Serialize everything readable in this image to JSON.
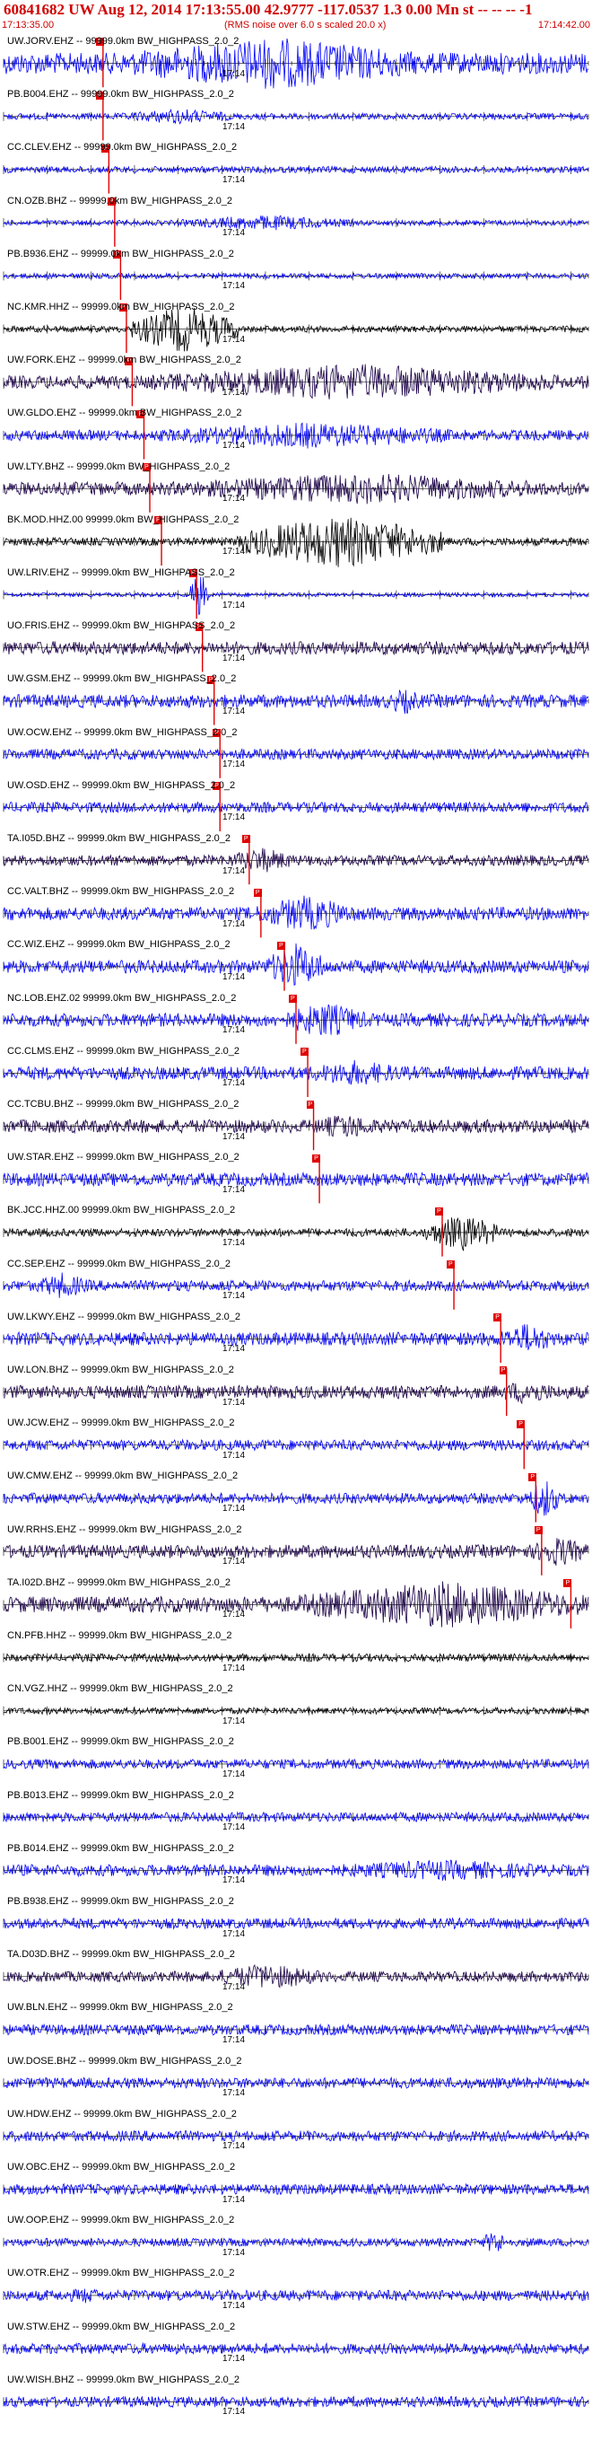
{
  "header": {
    "title": "60841682 UW Aug 12, 2014 17:13:55.00   42.9777 -117.0537  1.3 0.00 Mn st -- -- --  -1",
    "start_time": "17:13:35.00",
    "rms_note": "(RMS noise over 6.0 s scaled 20.0 x)",
    "end_time": "17:14:42.00"
  },
  "tick_time": "17:14",
  "colors": {
    "header_red": "#d00000",
    "blue": "#0000ff",
    "dark": "#1a0046",
    "black": "#000000",
    "pick": "#e00000"
  },
  "traces": [
    {
      "label": "UW.JORV.EHZ -- 99999.0km BW_HIGHPASS_2.0_2",
      "color": "blue",
      "amp": 0.4,
      "pick": 0.17,
      "event": [
        0.2,
        0.72,
        1.0
      ]
    },
    {
      "label": "PB.B004.EHZ -- 99999.0km BW_HIGHPASS_2.0_2",
      "color": "blue",
      "amp": 0.12,
      "pick": 0.17,
      "event": [
        0.2,
        0.4,
        0.3
      ]
    },
    {
      "label": "CC.CLEV.EHZ -- 99999.0km BW_HIGHPASS_2.0_2",
      "color": "blue",
      "amp": 0.12,
      "pick": 0.18
    },
    {
      "label": "CN.OZB.BHZ -- 99999.0km BW_HIGHPASS_2.0_2",
      "color": "blue",
      "amp": 0.1,
      "pick": 0.19,
      "event": [
        0.3,
        0.6,
        0.3
      ]
    },
    {
      "label": "PB.B936.EHZ -- 99999.0km BW_HIGHPASS_2.0_2",
      "color": "blue",
      "amp": 0.1,
      "pick": 0.2
    },
    {
      "label": "NC.KMR.HHZ -- 99999.0km BW_HIGHPASS_2.0_2",
      "color": "black",
      "amp": 0.12,
      "pick": 0.21,
      "event": [
        0.22,
        0.4,
        0.9
      ]
    },
    {
      "label": "UW.FORK.EHZ -- 99999.0km BW_HIGHPASS_2.0_2",
      "color": "dark",
      "amp": 0.25,
      "pick": 0.22,
      "event": [
        0.25,
        0.95,
        0.7
      ]
    },
    {
      "label": "UW.GLDO.EHZ -- 99999.0km BW_HIGHPASS_2.0_2",
      "color": "blue",
      "amp": 0.2,
      "pick": 0.24,
      "event": [
        0.25,
        0.8,
        0.5
      ]
    },
    {
      "label": "UW.LTY.BHZ -- 99999.0km BW_HIGHPASS_2.0_2",
      "color": "dark",
      "amp": 0.25,
      "pick": 0.25,
      "event": [
        0.28,
        0.95,
        0.6
      ]
    },
    {
      "label": "BK.MOD.HHZ.00 99999.0km BW_HIGHPASS_2.0_2",
      "color": "black",
      "amp": 0.15,
      "pick": 0.27,
      "event": [
        0.4,
        0.75,
        1.0
      ]
    },
    {
      "label": "UW.LRIV.EHZ -- 99999.0km BW_HIGHPASS_2.0_2",
      "color": "blue",
      "amp": 0.08,
      "pick": 0.33,
      "event": [
        0.32,
        0.35,
        0.9
      ]
    },
    {
      "label": "UO.FRIS.EHZ -- 99999.0km BW_HIGHPASS_2.0_2",
      "color": "dark",
      "amp": 0.25,
      "pick": 0.34
    },
    {
      "label": "UW.GSM.EHZ -- 99999.0km BW_HIGHPASS_2.0_2",
      "color": "blue",
      "amp": 0.25,
      "pick": 0.36,
      "event": [
        0.65,
        0.72,
        0.5
      ]
    },
    {
      "label": "UW.OCW.EHZ -- 99999.0km BW_HIGHPASS_2.0_2",
      "color": "blue",
      "amp": 0.2,
      "pick": 0.37
    },
    {
      "label": "UW.OSD.EHZ -- 99999.0km BW_HIGHPASS_2.0_2",
      "color": "blue",
      "amp": 0.2,
      "pick": 0.37
    },
    {
      "label": "TA.I05D.BHZ -- 99999.0km BW_HIGHPASS_2.0_2",
      "color": "dark",
      "amp": 0.2,
      "pick": 0.42,
      "event": [
        0.38,
        0.5,
        0.5
      ]
    },
    {
      "label": "CC.VALT.BHZ -- 99999.0km BW_HIGHPASS_2.0_2",
      "color": "blue",
      "amp": 0.25,
      "pick": 0.44,
      "event": [
        0.43,
        0.6,
        0.7
      ]
    },
    {
      "label": "CC.WIZ.EHZ -- 99999.0km BW_HIGHPASS_2.0_2",
      "color": "blue",
      "amp": 0.25,
      "pick": 0.48,
      "event": [
        0.45,
        0.55,
        0.9
      ]
    },
    {
      "label": "NC.LOB.EHZ.02 99999.0km BW_HIGHPASS_2.0_2",
      "color": "blue",
      "amp": 0.25,
      "pick": 0.5,
      "event": [
        0.48,
        0.62,
        0.7
      ]
    },
    {
      "label": "CC.CLMS.EHZ -- 99999.0km BW_HIGHPASS_2.0_2",
      "color": "blue",
      "amp": 0.25,
      "pick": 0.52,
      "event": [
        0.5,
        0.7,
        0.5
      ]
    },
    {
      "label": "CC.TCBU.BHZ -- 99999.0km BW_HIGHPASS_2.0_2",
      "color": "dark",
      "amp": 0.25,
      "pick": 0.53,
      "event": [
        0.52,
        0.65,
        0.5
      ]
    },
    {
      "label": "UW.STAR.EHZ -- 99999.0km BW_HIGHPASS_2.0_2",
      "color": "blue",
      "amp": 0.25,
      "pick": 0.54
    },
    {
      "label": "BK.JCC.HHZ.00 99999.0km BW_HIGHPASS_2.0_2",
      "color": "black",
      "amp": 0.15,
      "pick": 0.75,
      "event": [
        0.72,
        0.85,
        0.7
      ]
    },
    {
      "label": "CC.SEP.EHZ -- 99999.0km BW_HIGHPASS_2.0_2",
      "color": "blue",
      "amp": 0.2,
      "pick": 0.77,
      "event": [
        0.05,
        0.15,
        0.5
      ]
    },
    {
      "label": "UW.LKWY.EHZ -- 99999.0km BW_HIGHPASS_2.0_2",
      "color": "blue",
      "amp": 0.25,
      "pick": 0.85,
      "event": [
        0.84,
        0.95,
        0.6
      ]
    },
    {
      "label": "UW.LON.BHZ -- 99999.0km BW_HIGHPASS_2.0_2",
      "color": "dark",
      "amp": 0.25,
      "pick": 0.86,
      "event": [
        0.84,
        0.95,
        0.5
      ]
    },
    {
      "label": "UW.JCW.EHZ -- 99999.0km BW_HIGHPASS_2.0_2",
      "color": "blue",
      "amp": 0.2,
      "pick": 0.89
    },
    {
      "label": "UW.CMW.EHZ -- 99999.0km BW_HIGHPASS_2.0_2",
      "color": "blue",
      "amp": 0.2,
      "pick": 0.91,
      "event": [
        0.9,
        0.95,
        0.8
      ]
    },
    {
      "label": "UW.RRHS.EHZ -- 99999.0km BW_HIGHPASS_2.0_2",
      "color": "dark",
      "amp": 0.25,
      "pick": 0.92,
      "event": [
        0.9,
        1.0,
        0.6
      ]
    },
    {
      "label": "TA.I02D.BHZ -- 99999.0km BW_HIGHPASS_2.0_2",
      "color": "dark",
      "amp": 0.3,
      "pick": 0.97,
      "event": [
        0.5,
        1.0,
        0.9
      ]
    },
    {
      "label": "CN.PFB.HHZ -- 99999.0km BW_HIGHPASS_2.0_2",
      "color": "black",
      "amp": 0.15
    },
    {
      "label": "CN.VGZ.HHZ -- 99999.0km BW_HIGHPASS_2.0_2",
      "color": "black",
      "amp": 0.12
    },
    {
      "label": "PB.B001.EHZ -- 99999.0km BW_HIGHPASS_2.0_2",
      "color": "blue",
      "amp": 0.18
    },
    {
      "label": "PB.B013.EHZ -- 99999.0km BW_HIGHPASS_2.0_2",
      "color": "blue",
      "amp": 0.18
    },
    {
      "label": "PB.B014.EHZ -- 99999.0km BW_HIGHPASS_2.0_2",
      "color": "blue",
      "amp": 0.22,
      "event": [
        0.5,
        1.0,
        0.4
      ]
    },
    {
      "label": "PB.B938.EHZ -- 99999.0km BW_HIGHPASS_2.0_2",
      "color": "blue",
      "amp": 0.2
    },
    {
      "label": "TA.D03D.BHZ -- 99999.0km BW_HIGHPASS_2.0_2",
      "color": "dark",
      "amp": 0.2,
      "event": [
        0.35,
        0.55,
        0.5
      ]
    },
    {
      "label": "UW.BLN.EHZ -- 99999.0km BW_HIGHPASS_2.0_2",
      "color": "blue",
      "amp": 0.2
    },
    {
      "label": "UW.DOSE.BHZ -- 99999.0km BW_HIGHPASS_2.0_2",
      "color": "blue",
      "amp": 0.2
    },
    {
      "label": "UW.HDW.EHZ -- 99999.0km BW_HIGHPASS_2.0_2",
      "color": "blue",
      "amp": 0.2
    },
    {
      "label": "UW.OBC.EHZ -- 99999.0km BW_HIGHPASS_2.0_2",
      "color": "blue",
      "amp": 0.2
    },
    {
      "label": "UW.OOP.EHZ -- 99999.0km BW_HIGHPASS_2.0_2",
      "color": "blue",
      "amp": 0.15,
      "event": [
        0.82,
        0.86,
        0.5
      ]
    },
    {
      "label": "UW.OTR.EHZ -- 99999.0km BW_HIGHPASS_2.0_2",
      "color": "blue",
      "amp": 0.2,
      "event": [
        0.08,
        0.2,
        0.3
      ]
    },
    {
      "label": "UW.STW.EHZ -- 99999.0km BW_HIGHPASS_2.0_2",
      "color": "blue",
      "amp": 0.2
    },
    {
      "label": "UW.WISH.BHZ -- 99999.0km BW_HIGHPASS_2.0_2",
      "color": "blue",
      "amp": 0.2
    }
  ]
}
